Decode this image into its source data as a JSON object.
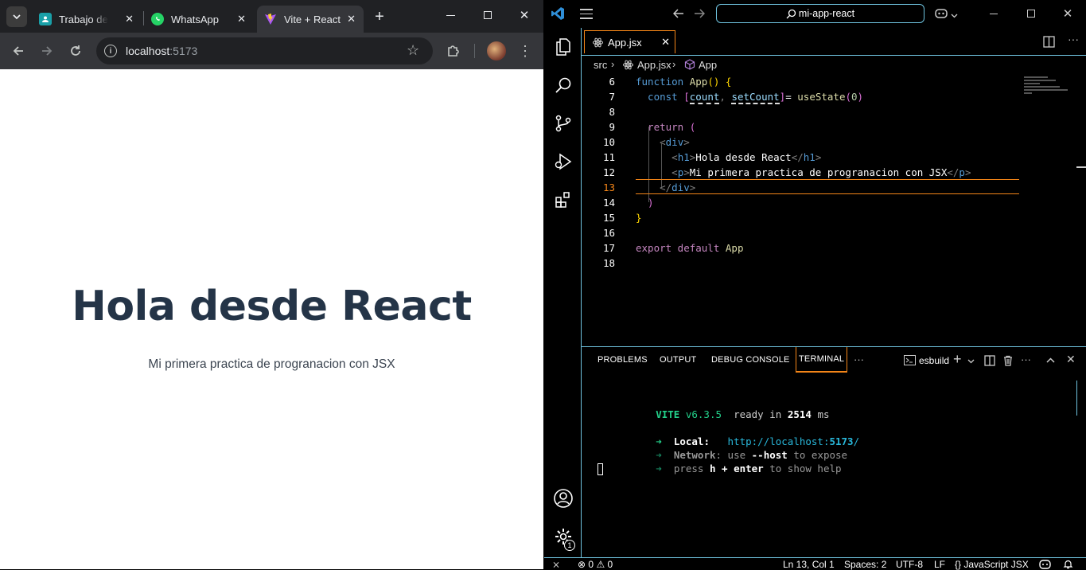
{
  "browser": {
    "tabs": [
      {
        "title": "Trabajo de cl",
        "favicon_color": "#1aa0a8"
      },
      {
        "title": "WhatsApp",
        "favicon_color": "#25d366"
      },
      {
        "title": "Vite + React",
        "favicon_color": "#a855f7"
      }
    ],
    "url_host": "localhost",
    "url_port": ":5173",
    "page": {
      "heading": "Hola desde React",
      "paragraph": "Mi primera practica de progranacion con JSX"
    }
  },
  "vscode": {
    "command_center": "mi-app-react",
    "file_tab": "App.jsx",
    "breadcrumb": {
      "folder": "src",
      "file": "App.jsx",
      "symbol": "App"
    },
    "code": [
      {
        "num": "6",
        "parts": [
          [
            "kw",
            "function "
          ],
          [
            "fn",
            "App"
          ],
          [
            "yel",
            "() {"
          ]
        ]
      },
      {
        "num": "7",
        "parts": [
          [
            "kw",
            "  const "
          ],
          [
            "mag",
            "["
          ],
          [
            "var",
            "count"
          ],
          [
            "pun",
            ", "
          ],
          [
            "var",
            "setCount"
          ],
          [
            "mag",
            "]"
          ],
          [
            "",
            "= "
          ],
          [
            "fn",
            "useState"
          ],
          [
            "mag",
            "("
          ],
          [
            "num",
            "0"
          ],
          [
            "mag",
            ")"
          ]
        ]
      },
      {
        "num": "8",
        "parts": []
      },
      {
        "num": "9",
        "parts": [
          [
            "kc",
            "  return "
          ],
          [
            "mag",
            "("
          ]
        ]
      },
      {
        "num": "10",
        "parts": [
          [
            "pun",
            "    <"
          ],
          [
            "tg",
            "div"
          ],
          [
            "pun",
            ">"
          ]
        ]
      },
      {
        "num": "11",
        "parts": [
          [
            "pun",
            "      <"
          ],
          [
            "tg",
            "h1"
          ],
          [
            "pun",
            ">"
          ],
          [
            "",
            "Hola desde React"
          ],
          [
            "pun",
            "</"
          ],
          [
            "tg",
            "h1"
          ],
          [
            "pun",
            ">"
          ]
        ]
      },
      {
        "num": "12",
        "parts": [
          [
            "pun",
            "      <"
          ],
          [
            "tg",
            "p"
          ],
          [
            "pun",
            ">"
          ],
          [
            "",
            "Mi primera practica de progranacion con JSX"
          ],
          [
            "pun",
            "</"
          ],
          [
            "tg",
            "p"
          ],
          [
            "pun",
            ">"
          ]
        ]
      },
      {
        "num": "13",
        "parts": [
          [
            "pun",
            "    </"
          ],
          [
            "tg",
            "div"
          ],
          [
            "pun",
            ">"
          ]
        ]
      },
      {
        "num": "14",
        "parts": [
          [
            "mag",
            "  )"
          ]
        ]
      },
      {
        "num": "15",
        "parts": [
          [
            "yel",
            "}"
          ]
        ]
      },
      {
        "num": "16",
        "parts": []
      },
      {
        "num": "17",
        "parts": [
          [
            "kc",
            "export default "
          ],
          [
            "fn",
            "App"
          ]
        ]
      },
      {
        "num": "18",
        "parts": []
      }
    ],
    "panel_tabs": [
      "PROBLEMS",
      "OUTPUT",
      "DEBUG CONSOLE",
      "TERMINAL"
    ],
    "terminal_name": "esbuild",
    "terminal": {
      "vite": "VITE",
      "version": "v6.3.5",
      "ready": "ready in",
      "ms": "2514",
      "ms_unit": "ms",
      "local_label": "Local:",
      "local_url_pre": "http://localhost:",
      "local_url_port": "5173",
      "local_url_post": "/",
      "network_label": "Network",
      "network_rest_1": ": use ",
      "network_flag": "--host",
      "network_rest_2": " to expose",
      "press": "press ",
      "press_keys": "h + enter",
      "press_rest": " to show help"
    },
    "status": {
      "errors": "0",
      "warnings": "0",
      "position": "Ln 13, Col 1",
      "spaces": "Spaces: 2",
      "encoding": "UTF-8",
      "eol": "LF",
      "language": "JavaScript JSX",
      "settings_badge": "1"
    }
  }
}
